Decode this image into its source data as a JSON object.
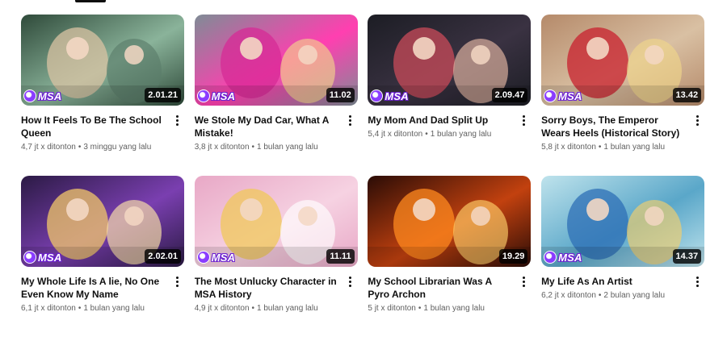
{
  "logo_text": "MSA",
  "videos": [
    {
      "title": "How It Feels To Be The School Queen",
      "views": "4,7 jt x ditonton",
      "age": "3 minggu yang lalu",
      "duration": "2.01.21",
      "palette": [
        "#2f4a3a",
        "#8ab39a",
        "#d9c3a3",
        "#5b7d6a"
      ]
    },
    {
      "title": "We Stole My Dad Car, What A Mistake!",
      "views": "3,8 jt x ditonton",
      "age": "1 bulan yang lalu",
      "duration": "11.02",
      "palette": [
        "#7f8c96",
        "#ff3fb0",
        "#d62b96",
        "#f2d38b"
      ]
    },
    {
      "title": "My Mom And Dad Split Up",
      "views": "5,4 jt x ditonton",
      "age": "1 bulan yang lalu",
      "duration": "2.09.47",
      "palette": [
        "#1c1d24",
        "#3a3242",
        "#c94b5a",
        "#e7b8a4"
      ]
    },
    {
      "title": "Sorry Boys, The Emperor Wears Heels (Historical Story)",
      "views": "5,8 jt x ditonton",
      "age": "1 bulan yang lalu",
      "duration": "13.42",
      "palette": [
        "#b58a6a",
        "#d9c0a3",
        "#c8202e",
        "#f0d58a"
      ]
    },
    {
      "title": "My Whole Life Is A lie, No One Even Know My Name",
      "views": "6,1 jt x ditonton",
      "age": "1 bulan yang lalu",
      "duration": "2.02.01",
      "palette": [
        "#2b1a44",
        "#7a3fb0",
        "#f2c76a",
        "#ffe7a8"
      ]
    },
    {
      "title": "The Most Unlucky Character in MSA History",
      "views": "4,9 jt x ditonton",
      "age": "1 bulan yang lalu",
      "duration": "11.11",
      "palette": [
        "#e8a8c6",
        "#f6d2e2",
        "#f0c85a",
        "#ffffff"
      ]
    },
    {
      "title": "My School Librarian Was A Pyro Archon",
      "views": "5 jt x ditonton",
      "age": "1 bulan yang lalu",
      "duration": "19.29",
      "palette": [
        "#2a0c06",
        "#c2410f",
        "#ff8a1f",
        "#ffcf6a"
      ]
    },
    {
      "title": "My Life As An Artist",
      "views": "6,2 jt x ditonton",
      "age": "2 bulan yang lalu",
      "duration": "14.37",
      "palette": [
        "#bfe3ec",
        "#5aa7c9",
        "#2e6fb5",
        "#f5d06b"
      ]
    }
  ]
}
